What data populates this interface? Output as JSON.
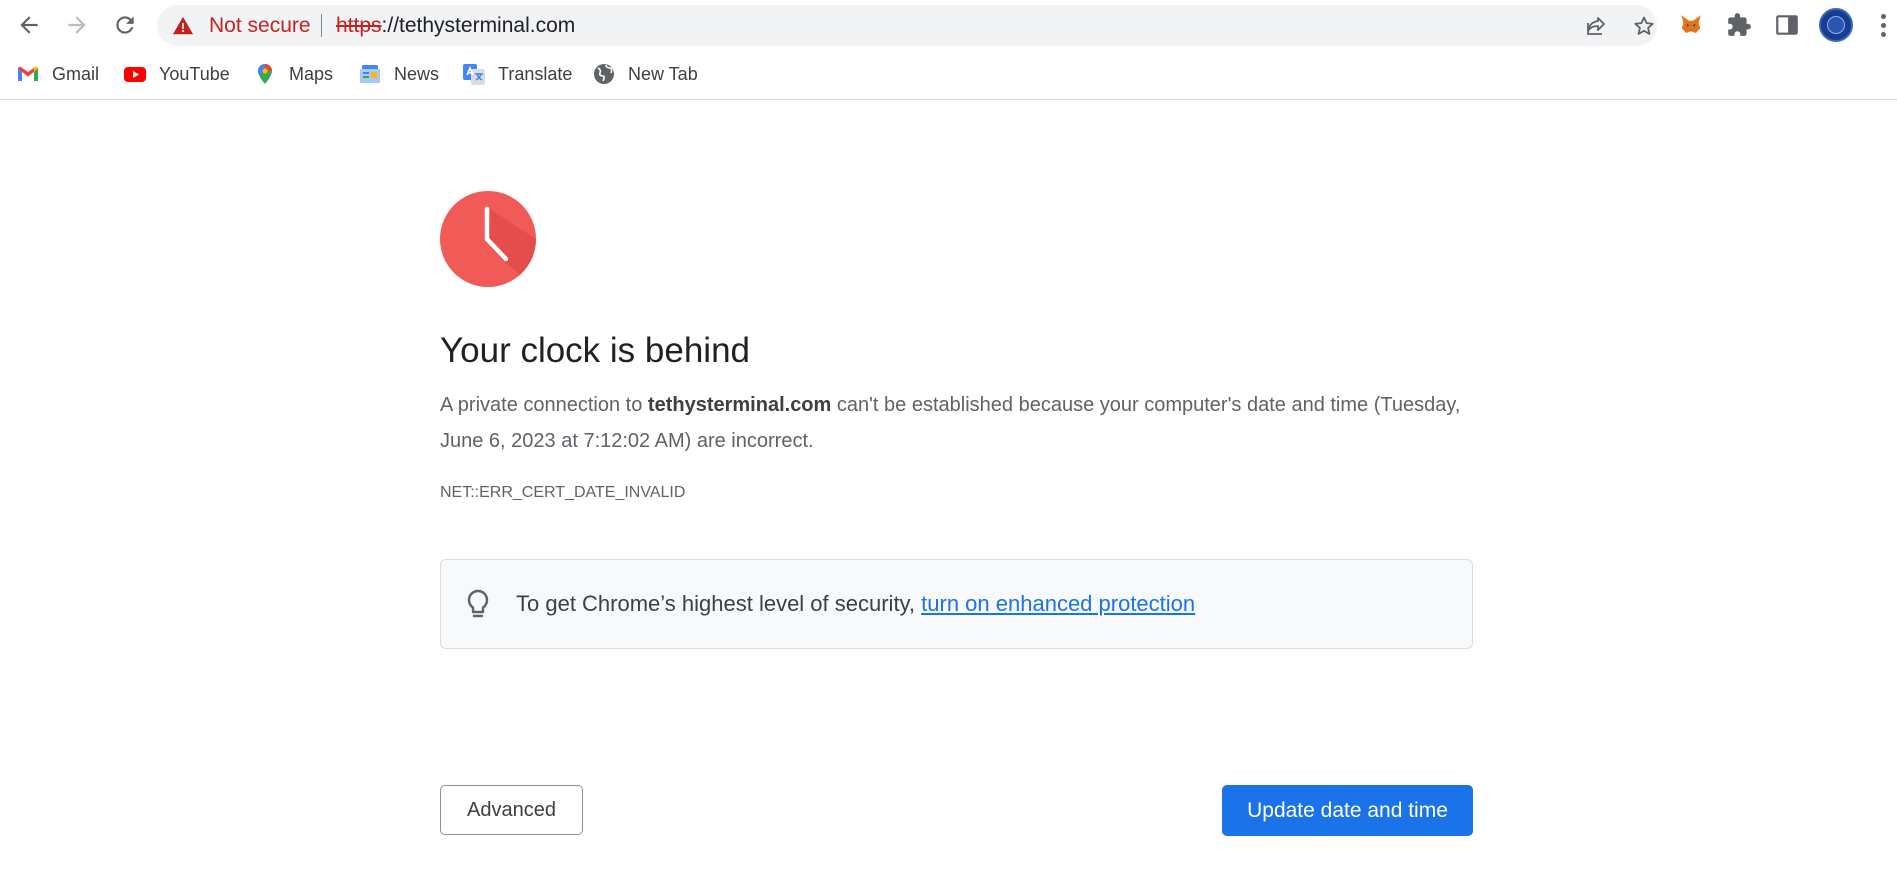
{
  "browser": {
    "nav": {
      "back_icon": "arrow-back-icon",
      "forward_icon": "arrow-forward-icon",
      "reload_icon": "reload-icon"
    },
    "omnibox": {
      "security_label": "Not secure",
      "security_icon": "warning-triangle-icon",
      "url_scheme": "https",
      "url_rest": "://tethysterminal.com",
      "share_icon": "share-icon",
      "bookmark_icon": "star-icon"
    },
    "extensions": [
      {
        "name": "metamask-fox-icon"
      },
      {
        "name": "puzzle-piece-icon"
      },
      {
        "name": "side-panel-icon"
      }
    ],
    "profile_icon": "profile-avatar",
    "menu_icon": "kebab-menu-icon"
  },
  "bookmarks": [
    {
      "label": "Gmail",
      "icon": "gmail-icon"
    },
    {
      "label": "YouTube",
      "icon": "youtube-icon"
    },
    {
      "label": "Maps",
      "icon": "maps-icon"
    },
    {
      "label": "News",
      "icon": "news-icon"
    },
    {
      "label": "Translate",
      "icon": "translate-icon"
    },
    {
      "label": "New Tab",
      "icon": "globe-icon"
    }
  ],
  "interstitial": {
    "heading": "Your clock is behind",
    "explain_prefix": "A private connection to ",
    "explain_domain": "tethysterminal.com",
    "explain_suffix": " can't be established because your computer's date and time (Tuesday, June 6, 2023 at 7:12:02 AM) are incorrect.",
    "error_code": "NET::ERR_CERT_DATE_INVALID",
    "enhanced_text": "To get Chrome’s highest level of security, ",
    "enhanced_link": "turn on enhanced protection",
    "advanced_button": "Advanced",
    "update_button": "Update date and time"
  },
  "colors": {
    "clock_red": "#f05a57",
    "not_secure_red": "#c5221f",
    "primary_blue": "#1a73e8"
  }
}
